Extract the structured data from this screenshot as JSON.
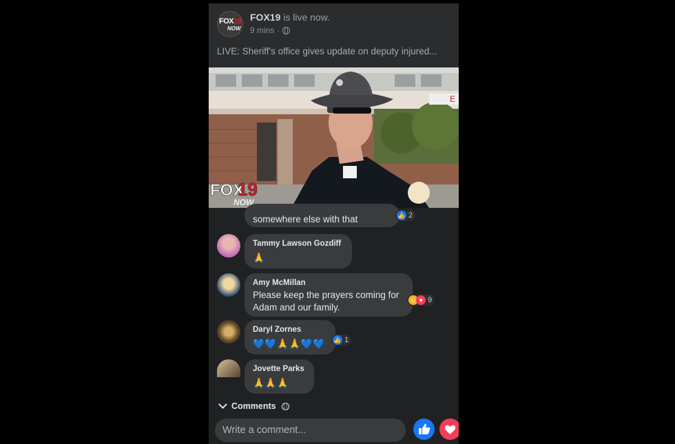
{
  "post": {
    "page_name": "FOX19",
    "status_text": "is live now.",
    "time": "9 mins",
    "separator": "·",
    "live_text": "LIVE: Sheriff's office gives update on deputy injured...",
    "avatar_logo_top": "FOX",
    "avatar_logo_num": "19",
    "avatar_logo_bottom": "NOW"
  },
  "video": {
    "watermark_brand": "FOX",
    "watermark_number": "19",
    "watermark_now": "NOW",
    "sign_text": "E"
  },
  "comments": [
    {
      "author": "",
      "text": "somewhere else with that",
      "reaction_count": "2"
    },
    {
      "author": "Tammy Lawson Gozdiff",
      "text": "🙏"
    },
    {
      "author": "Amy McMillan",
      "line1": "Please keep the prayers coming for",
      "line2": "Adam and our family.",
      "reaction_count": "9"
    },
    {
      "author": "Daryl Zornes",
      "text": "💙💙🙏🙏💙💙",
      "reaction_count": "1"
    },
    {
      "author": "Jovette Parks",
      "text": "🙏🙏🙏"
    }
  ],
  "footer": {
    "comments_label": "Comments",
    "write_placeholder": "Write a comment..."
  },
  "colors": {
    "like": "#1877f2",
    "love": "#f33e58",
    "bubble": "#3a3b3d",
    "background": "#000000"
  },
  "icons": [
    "globe-icon",
    "chevron-down-icon",
    "like-icon",
    "love-icon",
    "care-icon"
  ]
}
